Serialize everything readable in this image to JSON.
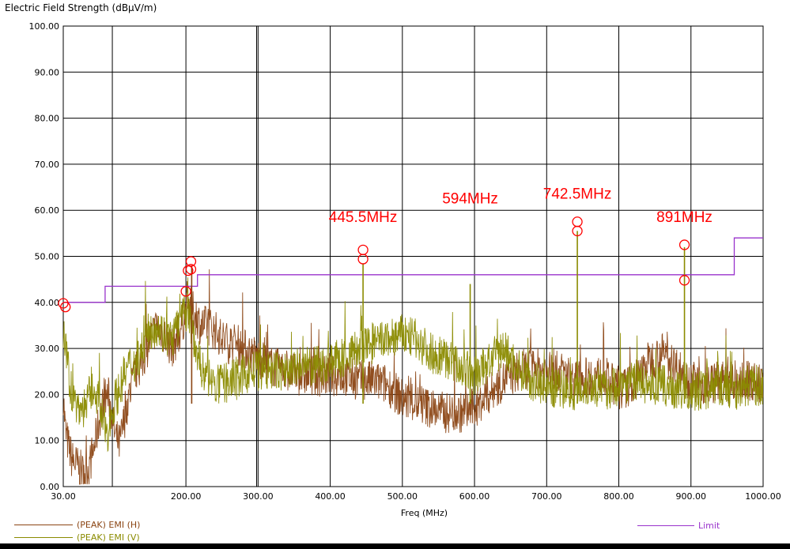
{
  "chart_data": {
    "type": "line",
    "y_title": "Electric Field Strength (dBμV/m)",
    "x_title": "Freq (MHz)",
    "xlim": [
      30,
      1000
    ],
    "ylim": [
      0,
      100
    ],
    "x_ticks": [
      "30.00",
      "200.00",
      "300.00",
      "400.00",
      "500.00",
      "600.00",
      "700.00",
      "800.00",
      "900.00",
      "1000.00"
    ],
    "x_tick_values": [
      30,
      200,
      300,
      400,
      500,
      600,
      700,
      800,
      900,
      1000
    ],
    "y_ticks": [
      "0.00",
      "10.00",
      "20.00",
      "30.00",
      "40.00",
      "50.00",
      "60.00",
      "70.00",
      "80.00",
      "90.00",
      "100.00"
    ],
    "y_tick_values": [
      0,
      10,
      20,
      30,
      40,
      50,
      60,
      70,
      80,
      90,
      100
    ],
    "grid": true,
    "extra_gridlines_x": [
      98,
      298
    ],
    "series": [
      {
        "name": "(PEAK) EMI (H)",
        "color": "#8B4513",
        "x": [
          30,
          33,
          37,
          42,
          47,
          52,
          57,
          62,
          67,
          72,
          77,
          82,
          87,
          92,
          97,
          102,
          108,
          114,
          120,
          130,
          140,
          150,
          160,
          170,
          180,
          190,
          200,
          205,
          210,
          215,
          220,
          230,
          240,
          250,
          260,
          270,
          280,
          290,
          300,
          320,
          340,
          360,
          380,
          400,
          420,
          440,
          460,
          480,
          500,
          520,
          540,
          560,
          580,
          600,
          620,
          640,
          660,
          680,
          700,
          720,
          740,
          760,
          780,
          800,
          820,
          840,
          860,
          880,
          900,
          920,
          940,
          960,
          980,
          1000
        ],
        "y": [
          20,
          12,
          9,
          6,
          5,
          4,
          3,
          3,
          5,
          8,
          12,
          16,
          19,
          20,
          16,
          11,
          9,
          14,
          19,
          25,
          27,
          32,
          35,
          33,
          30,
          33,
          38,
          40,
          38,
          37,
          35,
          35,
          34,
          32,
          31,
          31,
          30,
          29,
          28,
          26,
          25,
          24,
          24,
          24,
          24,
          23,
          23,
          22,
          19,
          18,
          17,
          16,
          16,
          17,
          20,
          23,
          25,
          26,
          25,
          25,
          23,
          24,
          24,
          21,
          22,
          27,
          29,
          26,
          23,
          22,
          23,
          22,
          23,
          22
        ],
        "peak_x": [
          30,
          33,
          200,
          203,
          207,
          445.5,
          742.5,
          891
        ],
        "peak_y": [
          39.8,
          39,
          42.4,
          46.9,
          48.9,
          49.4,
          55.5,
          44.8
        ]
      },
      {
        "name": "(PEAK) EMI (V)",
        "color": "#8B8B00",
        "x": [
          30,
          33,
          37,
          42,
          47,
          52,
          57,
          62,
          67,
          72,
          77,
          82,
          87,
          92,
          97,
          102,
          108,
          114,
          120,
          130,
          140,
          150,
          160,
          170,
          180,
          190,
          200,
          205,
          210,
          215,
          220,
          230,
          240,
          250,
          260,
          270,
          280,
          290,
          300,
          320,
          340,
          360,
          380,
          400,
          420,
          440,
          460,
          480,
          500,
          520,
          540,
          560,
          580,
          600,
          620,
          640,
          660,
          680,
          700,
          720,
          740,
          760,
          780,
          800,
          820,
          840,
          860,
          880,
          900,
          920,
          940,
          960,
          980,
          1000
        ],
        "y": [
          33,
          30,
          25,
          20,
          18,
          17,
          17,
          18,
          20,
          21,
          20,
          16,
          13,
          12,
          16,
          19,
          21,
          24,
          26,
          27,
          30,
          34,
          35,
          33,
          32,
          35,
          38,
          37,
          33,
          30,
          26,
          24,
          22,
          22,
          23,
          23,
          24,
          25,
          25,
          25,
          25,
          26,
          26,
          27,
          28,
          30,
          31,
          32,
          33,
          32,
          29,
          28,
          26,
          24,
          27,
          30,
          26,
          23,
          22,
          21,
          21,
          22,
          21,
          22,
          23,
          22,
          22,
          21,
          21,
          21,
          22,
          21,
          22,
          22
        ],
        "peak_x": [
          207,
          445.5,
          742.5,
          891
        ],
        "peak_y": [
          47.2,
          51.4,
          57.5,
          52.5
        ]
      },
      {
        "name": "Limit",
        "color": "#9933CC",
        "step": true,
        "x": [
          30,
          88,
          88,
          216,
          216,
          960,
          960,
          1000
        ],
        "y": [
          40,
          40,
          43.5,
          43.5,
          46,
          46,
          54,
          54
        ]
      }
    ],
    "spikes": [
      {
        "x": 445.5,
        "y": 48.5,
        "color": "#8B8B00"
      },
      {
        "x": 742.5,
        "y": 55.5,
        "color": "#8B8B00"
      },
      {
        "x": 891,
        "y": 52,
        "color": "#8B8B00"
      },
      {
        "x": 594,
        "y": 44,
        "color": "#8B8B00"
      },
      {
        "x": 208,
        "y": 48,
        "color": "#8B4513"
      }
    ],
    "annotations": [
      {
        "text": "445.5MHz",
        "x": 445.5,
        "y": 57.5
      },
      {
        "text": "594MHz",
        "x": 594,
        "y": 61.5
      },
      {
        "text": "742.5MHz",
        "x": 742.5,
        "y": 62.5
      },
      {
        "text": "891MHz",
        "x": 891,
        "y": 57.5
      }
    ],
    "annotation_color": "#FF0000",
    "marker_color": "#FF0000"
  },
  "legend": {
    "h": "(PEAK) EMI (H)",
    "v": "(PEAK) EMI (V)",
    "limit": "Limit"
  }
}
